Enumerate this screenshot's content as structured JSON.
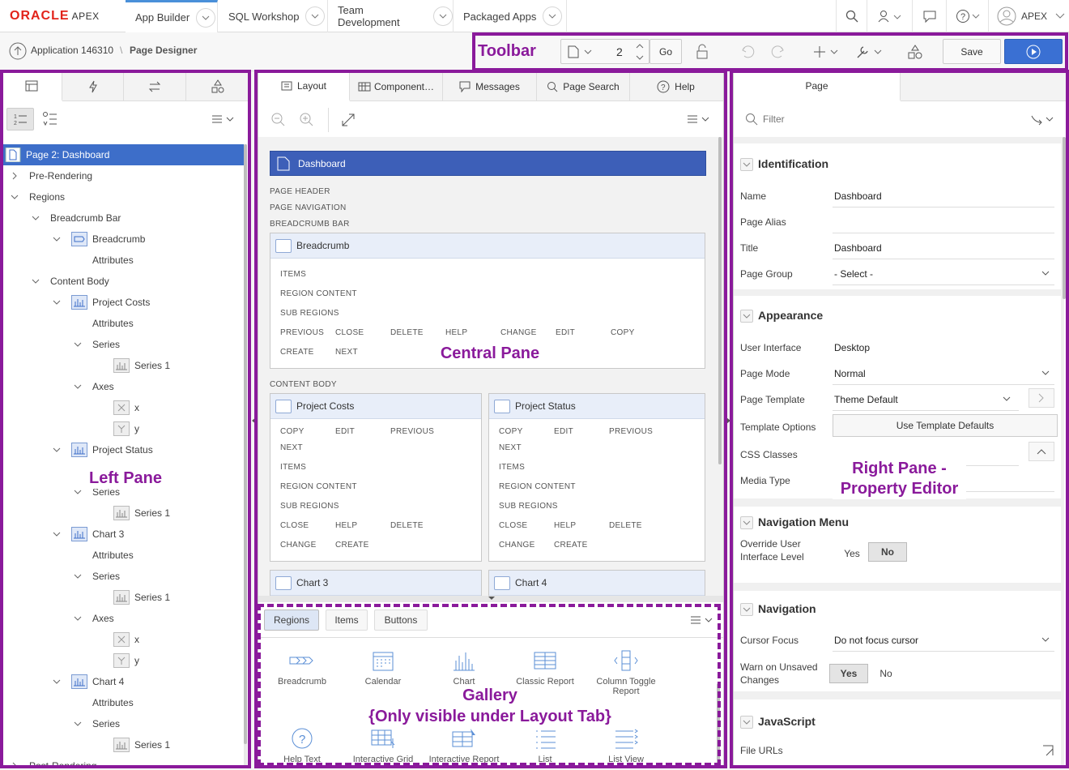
{
  "topbar": {
    "logo_brand": "ORACLE",
    "logo_product": "APEX",
    "tabs": [
      "App Builder",
      "SQL Workshop",
      "Team Development",
      "Packaged Apps"
    ],
    "user": "APEX"
  },
  "subbar": {
    "breadcrumb_app": "Application 146310",
    "breadcrumb_sep": "\\",
    "breadcrumb_page": "Page Designer",
    "page_number": "2",
    "go_label": "Go",
    "save_label": "Save"
  },
  "annotations": {
    "toolbar": "Toolbar",
    "left": "Left Pane",
    "central": "Central Pane",
    "gallery_title": "Gallery",
    "gallery_note": "{Only visible under Layout Tab}",
    "right_line1": "Right Pane -",
    "right_line2": "Property Editor"
  },
  "left_tree": [
    {
      "label": "Page 2: Dashboard",
      "selected": true
    },
    {
      "label": "Pre-Rendering"
    },
    {
      "label": "Regions"
    },
    {
      "label": "Breadcrumb Bar"
    },
    {
      "label": "Breadcrumb"
    },
    {
      "label": "Attributes"
    },
    {
      "label": "Content Body"
    },
    {
      "label": "Project Costs"
    },
    {
      "label": "Attributes"
    },
    {
      "label": "Series"
    },
    {
      "label": "Series 1"
    },
    {
      "label": "Axes"
    },
    {
      "label": "x"
    },
    {
      "label": "y"
    },
    {
      "label": "Project Status"
    },
    {
      "label": "Series"
    },
    {
      "label": "Series 1"
    },
    {
      "label": "Chart 3"
    },
    {
      "label": "Attributes"
    },
    {
      "label": "Series"
    },
    {
      "label": "Series 1"
    },
    {
      "label": "Axes"
    },
    {
      "label": "x"
    },
    {
      "label": "y"
    },
    {
      "label": "Chart 4"
    },
    {
      "label": "Attributes"
    },
    {
      "label": "Series"
    },
    {
      "label": "Series 1"
    },
    {
      "label": "Post-Rendering"
    }
  ],
  "central": {
    "tabs": [
      "Layout",
      "Component…",
      "Messages",
      "Page Search",
      "Help"
    ],
    "page_title": "Dashboard",
    "page_header": "PAGE HEADER",
    "page_navigation": "PAGE NAVIGATION",
    "breadcrumb_bar": "BREADCRUMB BAR",
    "content_body": "CONTENT BODY",
    "breadcrumb_region": "Breadcrumb",
    "breadcrumb_lines": [
      "ITEMS",
      "REGION CONTENT",
      "SUB REGIONS"
    ],
    "breadcrumb_positions_row1": [
      "PREVIOUS",
      "CLOSE",
      "DELETE",
      "HELP",
      "CHANGE",
      "EDIT",
      "COPY"
    ],
    "breadcrumb_positions_row2": [
      "CREATE",
      "NEXT"
    ],
    "region_left": "Project Costs",
    "region_right": "Project Status",
    "region_positions_row1": [
      "COPY",
      "EDIT",
      "PREVIOUS"
    ],
    "region_positions_row2": [
      "NEXT"
    ],
    "region_lines": [
      "ITEMS",
      "REGION CONTENT",
      "SUB REGIONS"
    ],
    "region_positions_row3": [
      "CLOSE",
      "HELP",
      "DELETE"
    ],
    "region_positions_row4": [
      "CHANGE",
      "CREATE"
    ],
    "chart3": "Chart 3",
    "chart4": "Chart 4"
  },
  "gallery": {
    "tabs": [
      "Regions",
      "Items",
      "Buttons"
    ],
    "items": [
      "Breadcrumb",
      "Calendar",
      "Chart",
      "Classic Report",
      "Column Toggle Report",
      "Help Text",
      "Interactive Grid",
      "Interactive Report",
      "List",
      "List View"
    ]
  },
  "right": {
    "tab": "Page",
    "filter_placeholder": "Filter",
    "sections": [
      "Identification",
      "Appearance",
      "Navigation Menu",
      "Navigation",
      "JavaScript"
    ],
    "identification": [
      {
        "k": "Name",
        "v": "Dashboard"
      },
      {
        "k": "Page Alias",
        "v": ""
      },
      {
        "k": "Title",
        "v": "Dashboard"
      },
      {
        "k": "Page Group",
        "v": "- Select -"
      }
    ],
    "appearance": [
      {
        "k": "User Interface",
        "v": "Desktop"
      },
      {
        "k": "Page Mode",
        "v": "Normal"
      },
      {
        "k": "Page Template",
        "v": "Theme Default"
      },
      {
        "k": "Template Options",
        "v": "Use Template Defaults"
      },
      {
        "k": "CSS Classes",
        "v": ""
      },
      {
        "k": "Media Type",
        "v": ""
      }
    ],
    "override_label_1": "Override User",
    "override_label_2": "Interface Level",
    "yes": "Yes",
    "no": "No",
    "cursor_focus_label": "Cursor Focus",
    "cursor_focus_value": "Do not focus cursor",
    "warn_label_1": "Warn on Unsaved",
    "warn_label_2": "Changes",
    "file_urls": "File URLs"
  }
}
